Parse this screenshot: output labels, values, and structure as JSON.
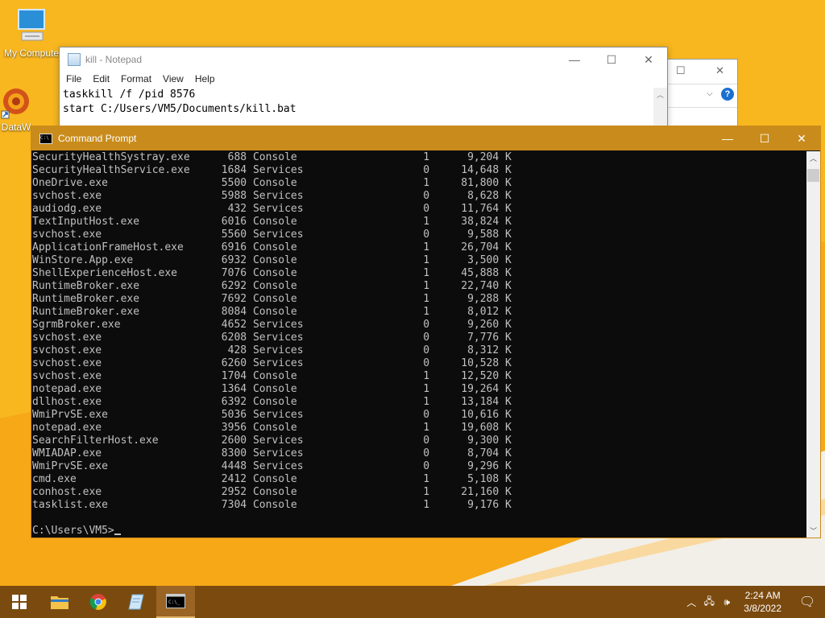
{
  "desktop": {
    "icons": [
      {
        "label": "My Computer",
        "icon": "monitor-icon"
      },
      {
        "label": "DataW",
        "icon": "mandala-icon"
      }
    ]
  },
  "notepad": {
    "title": "kill - Notepad",
    "menu": [
      "File",
      "Edit",
      "Format",
      "View",
      "Help"
    ],
    "lines": [
      "taskkill /f /pid 8576",
      "start C:/Users/VM5/Documents/kill.bat"
    ]
  },
  "cmd": {
    "title": "Command Prompt",
    "rows": [
      {
        "name": "SecurityHealthSystray.exe",
        "pid": "688",
        "session": "Console",
        "num": "1",
        "mem": "9,204 K"
      },
      {
        "name": "SecurityHealthService.exe",
        "pid": "1684",
        "session": "Services",
        "num": "0",
        "mem": "14,648 K"
      },
      {
        "name": "OneDrive.exe",
        "pid": "5500",
        "session": "Console",
        "num": "1",
        "mem": "81,800 K"
      },
      {
        "name": "svchost.exe",
        "pid": "5988",
        "session": "Services",
        "num": "0",
        "mem": "8,628 K"
      },
      {
        "name": "audiodg.exe",
        "pid": "432",
        "session": "Services",
        "num": "0",
        "mem": "11,764 K"
      },
      {
        "name": "TextInputHost.exe",
        "pid": "6016",
        "session": "Console",
        "num": "1",
        "mem": "38,824 K"
      },
      {
        "name": "svchost.exe",
        "pid": "5560",
        "session": "Services",
        "num": "0",
        "mem": "9,588 K"
      },
      {
        "name": "ApplicationFrameHost.exe",
        "pid": "6916",
        "session": "Console",
        "num": "1",
        "mem": "26,704 K"
      },
      {
        "name": "WinStore.App.exe",
        "pid": "6932",
        "session": "Console",
        "num": "1",
        "mem": "3,500 K"
      },
      {
        "name": "ShellExperienceHost.exe",
        "pid": "7076",
        "session": "Console",
        "num": "1",
        "mem": "45,888 K"
      },
      {
        "name": "RuntimeBroker.exe",
        "pid": "6292",
        "session": "Console",
        "num": "1",
        "mem": "22,740 K"
      },
      {
        "name": "RuntimeBroker.exe",
        "pid": "7692",
        "session": "Console",
        "num": "1",
        "mem": "9,288 K"
      },
      {
        "name": "RuntimeBroker.exe",
        "pid": "8084",
        "session": "Console",
        "num": "1",
        "mem": "8,012 K"
      },
      {
        "name": "SgrmBroker.exe",
        "pid": "4652",
        "session": "Services",
        "num": "0",
        "mem": "9,260 K"
      },
      {
        "name": "svchost.exe",
        "pid": "6208",
        "session": "Services",
        "num": "0",
        "mem": "7,776 K"
      },
      {
        "name": "svchost.exe",
        "pid": "428",
        "session": "Services",
        "num": "0",
        "mem": "8,312 K"
      },
      {
        "name": "svchost.exe",
        "pid": "6260",
        "session": "Services",
        "num": "0",
        "mem": "10,528 K"
      },
      {
        "name": "svchost.exe",
        "pid": "1704",
        "session": "Console",
        "num": "1",
        "mem": "12,520 K"
      },
      {
        "name": "notepad.exe",
        "pid": "1364",
        "session": "Console",
        "num": "1",
        "mem": "19,264 K"
      },
      {
        "name": "dllhost.exe",
        "pid": "6392",
        "session": "Console",
        "num": "1",
        "mem": "13,184 K"
      },
      {
        "name": "WmiPrvSE.exe",
        "pid": "5036",
        "session": "Services",
        "num": "0",
        "mem": "10,616 K"
      },
      {
        "name": "notepad.exe",
        "pid": "3956",
        "session": "Console",
        "num": "1",
        "mem": "19,608 K"
      },
      {
        "name": "SearchFilterHost.exe",
        "pid": "2600",
        "session": "Services",
        "num": "0",
        "mem": "9,300 K"
      },
      {
        "name": "WMIADAP.exe",
        "pid": "8300",
        "session": "Services",
        "num": "0",
        "mem": "8,704 K"
      },
      {
        "name": "WmiPrvSE.exe",
        "pid": "4448",
        "session": "Services",
        "num": "0",
        "mem": "9,296 K"
      },
      {
        "name": "cmd.exe",
        "pid": "2412",
        "session": "Console",
        "num": "1",
        "mem": "5,108 K"
      },
      {
        "name": "conhost.exe",
        "pid": "2952",
        "session": "Console",
        "num": "1",
        "mem": "21,160 K"
      },
      {
        "name": "tasklist.exe",
        "pid": "7304",
        "session": "Console",
        "num": "1",
        "mem": "9,176 K"
      }
    ],
    "prompt": "C:\\Users\\VM5>"
  },
  "taskbar": {
    "buttons": [
      {
        "name": "start-button",
        "icon": "windows-logo-icon"
      },
      {
        "name": "file-explorer-button",
        "icon": "folder-icon"
      },
      {
        "name": "chrome-button",
        "icon": "chrome-icon"
      },
      {
        "name": "notepad-button",
        "icon": "notepad-icon"
      },
      {
        "name": "cmd-button",
        "icon": "cmd-icon",
        "active": true
      }
    ],
    "time": "2:24 AM",
    "date": "3/8/2022"
  },
  "colors": {
    "wallpaper": "#f6a817",
    "cmd_titlebar": "#c98c1c",
    "taskbar": "#7b4a0f"
  }
}
